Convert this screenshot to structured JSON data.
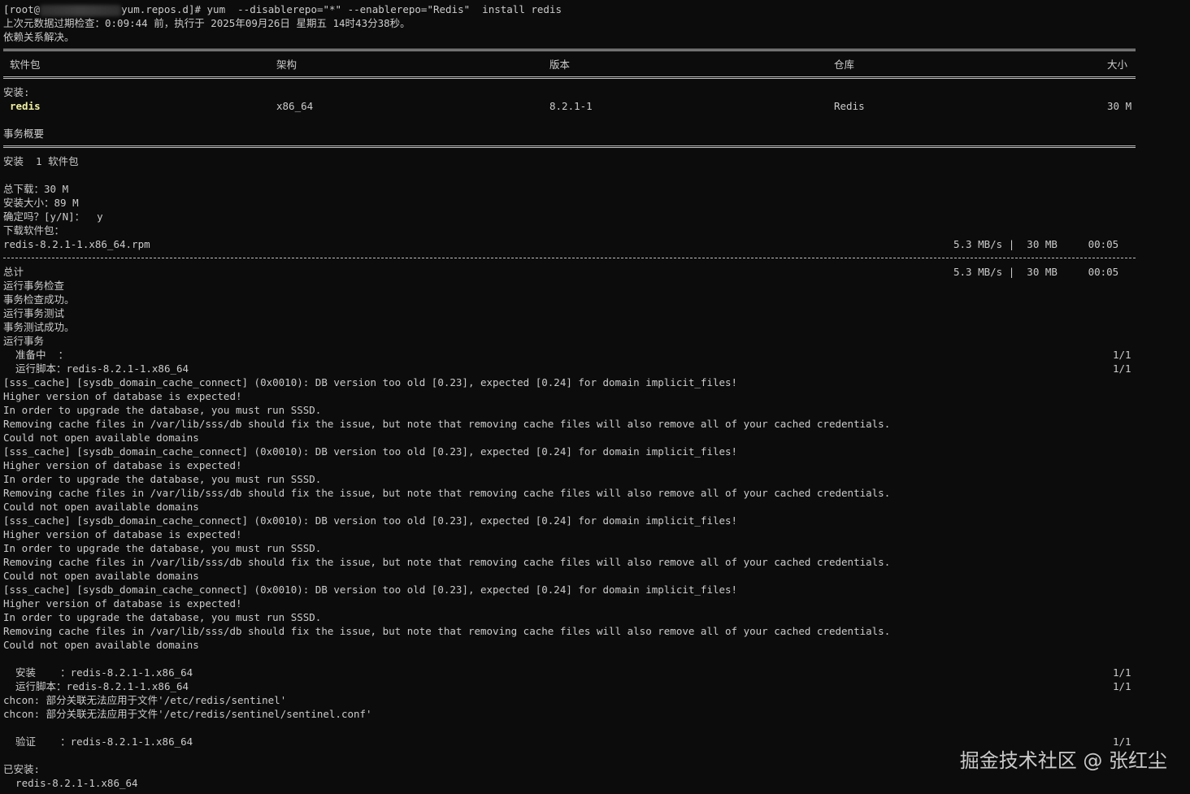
{
  "terminal": {
    "prompt_prefix": "[root@",
    "prompt_suffix": "yum.repos.d]# yum  --disablerepo=\"*\" --enablerepo=\"Redis\"  install redis",
    "metadata_check": "上次元数据过期检查：0:09:44 前，执行于 2025年09月26日 星期五 14时43分38秒。",
    "deps_resolved": "依赖关系解决。",
    "table_header": {
      "package": "软件包",
      "arch": "架构",
      "version": "版本",
      "repo": "仓库",
      "size": "大小"
    },
    "installing_label": "安装:",
    "package_row": {
      "name": "redis",
      "arch": "x86_64",
      "version": "8.2.1-1",
      "repo": "Redis",
      "size": "30 M"
    },
    "summary_title": "事务概要",
    "install_count": "安装  1 软件包",
    "total_download": "总下载：30 M",
    "install_size": "安装大小：89 M",
    "confirm_prompt": "确定吗？[y/N]：  y",
    "downloading": "下载软件包：",
    "rpm_file": "redis-8.2.1-1.x86_64.rpm",
    "download_stats": "5.3 MB/s |  30 MB     00:05",
    "total_label": "总计",
    "total_stats": "5.3 MB/s |  30 MB     00:05",
    "tx_check": "运行事务检查",
    "tx_check_ok": "事务检查成功。",
    "tx_test": "运行事务测试",
    "tx_test_ok": "事务测试成功。",
    "tx_run": "运行事务",
    "preparing": "  准备中  ：",
    "preparing_count": "1/1",
    "scriptlet1": "  运行脚本：redis-8.2.1-1.x86_64",
    "scriptlet1_count": "1/1",
    "sss_blocks": [
      {
        "l1": "[sss_cache] [sysdb_domain_cache_connect] (0x0010): DB version too old [0.23], expected [0.24] for domain implicit_files!",
        "l2": "Higher version of database is expected!",
        "l3": "In order to upgrade the database, you must run SSSD.",
        "l4": "Removing cache files in /var/lib/sss/db should fix the issue, but note that removing cache files will also remove all of your cached credentials.",
        "l5": "Could not open available domains"
      },
      {
        "l1": "[sss_cache] [sysdb_domain_cache_connect] (0x0010): DB version too old [0.23], expected [0.24] for domain implicit_files!",
        "l2": "Higher version of database is expected!",
        "l3": "In order to upgrade the database, you must run SSSD.",
        "l4": "Removing cache files in /var/lib/sss/db should fix the issue, but note that removing cache files will also remove all of your cached credentials.",
        "l5": "Could not open available domains"
      },
      {
        "l1": "[sss_cache] [sysdb_domain_cache_connect] (0x0010): DB version too old [0.23], expected [0.24] for domain implicit_files!",
        "l2": "Higher version of database is expected!",
        "l3": "In order to upgrade the database, you must run SSSD.",
        "l4": "Removing cache files in /var/lib/sss/db should fix the issue, but note that removing cache files will also remove all of your cached credentials.",
        "l5": "Could not open available domains"
      },
      {
        "l1": "[sss_cache] [sysdb_domain_cache_connect] (0x0010): DB version too old [0.23], expected [0.24] for domain implicit_files!",
        "l2": "Higher version of database is expected!",
        "l3": "In order to upgrade the database, you must run SSSD.",
        "l4": "Removing cache files in /var/lib/sss/db should fix the issue, but note that removing cache files will also remove all of your cached credentials.",
        "l5": "Could not open available domains"
      }
    ],
    "install_step": "  安装    ：redis-8.2.1-1.x86_64",
    "install_step_count": "1/1",
    "scriptlet2": "  运行脚本：redis-8.2.1-1.x86_64",
    "scriptlet2_count": "1/1",
    "chcon1": "chcon: 部分关联无法应用于文件'/etc/redis/sentinel'",
    "chcon2": "chcon: 部分关联无法应用于文件'/etc/redis/sentinel/sentinel.conf'",
    "verify_step": "  验证    ：redis-8.2.1-1.x86_64",
    "verify_step_count": "1/1",
    "installed_label": "已安装:",
    "installed_pkg": "  redis-8.2.1-1.x86_64"
  },
  "watermark": "掘金技术社区 @ 张红尘"
}
